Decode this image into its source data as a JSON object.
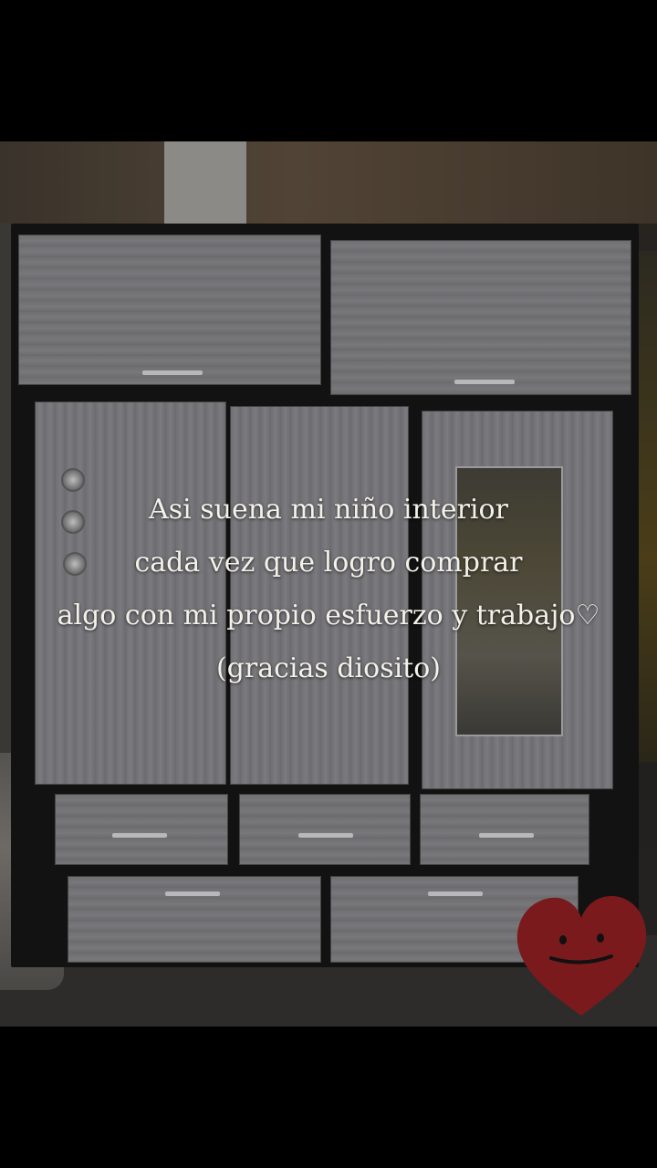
{
  "caption": {
    "line1": "Asi suena mi niño interior",
    "line2": "cada vez que logro comprar",
    "line3": "algo con mi propio esfuerzo y trabajo♡",
    "line4": "(gracias diosito)"
  },
  "sticker": {
    "icon": "smiling-heart-icon",
    "color": "#7a1a1c"
  },
  "photo": {
    "subject": "wardrobe-photo"
  }
}
